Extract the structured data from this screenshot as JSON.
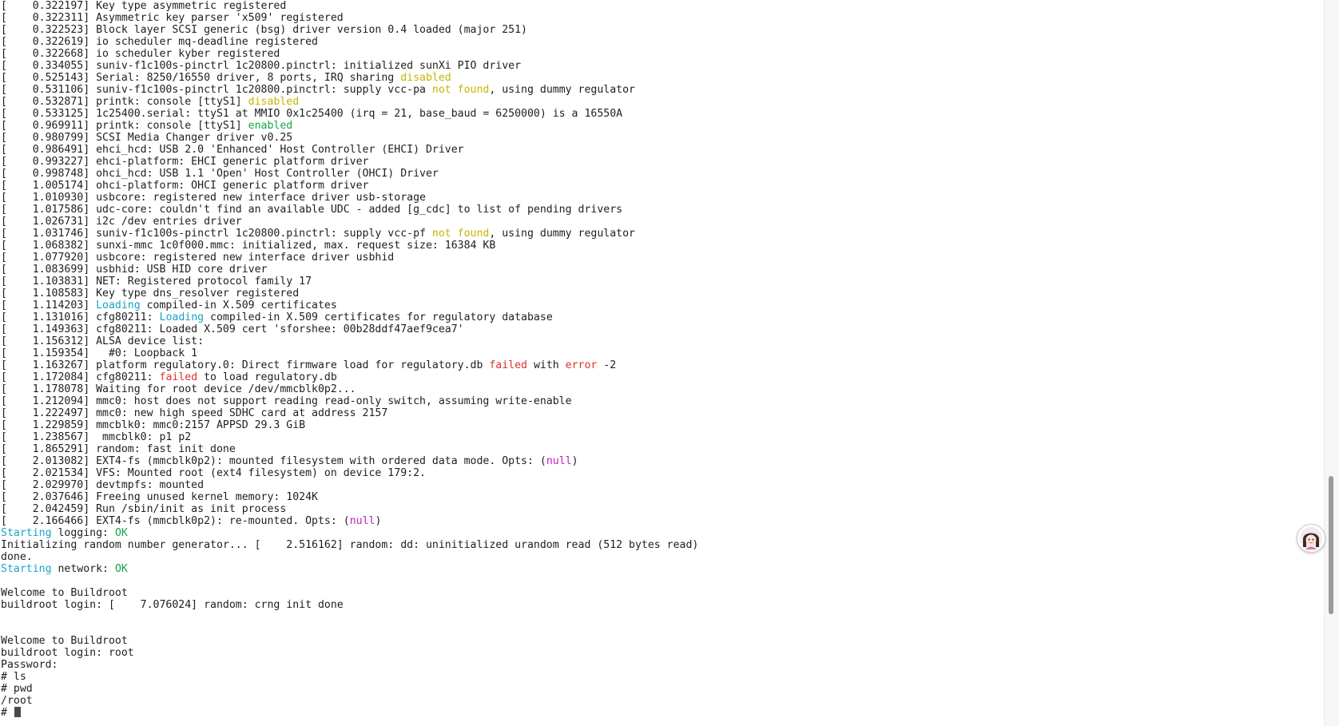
{
  "colors": {
    "plain": "#1e1e1e",
    "yellow": "#c8b400",
    "green": "#17a34a",
    "cyan": "#1aa3c2",
    "red": "#e0302b",
    "magenta": "#c020c0"
  },
  "scrollbar": {
    "position_fraction": 0.81,
    "visible_fraction": 0.19
  },
  "avatar": {
    "icon": "assistant-avatar-icon"
  },
  "terminal": {
    "lines": [
      [
        [
          "plain",
          "[    0.322197] Key type asymmetric registered"
        ]
      ],
      [
        [
          "plain",
          "[    0.322311] Asymmetric key parser 'x509' registered"
        ]
      ],
      [
        [
          "plain",
          "[    0.322523] Block layer SCSI generic (bsg) driver version 0.4 loaded (major 251)"
        ]
      ],
      [
        [
          "plain",
          "[    0.322619] io scheduler mq-deadline registered"
        ]
      ],
      [
        [
          "plain",
          "[    0.322668] io scheduler kyber registered"
        ]
      ],
      [
        [
          "plain",
          "[    0.334055] suniv-f1c100s-pinctrl 1c20800.pinctrl: initialized sunXi PIO driver"
        ]
      ],
      [
        [
          "plain",
          "[    0.525143] Serial: 8250/16550 driver, 8 ports, IRQ sharing "
        ],
        [
          "yellow",
          "disabled"
        ]
      ],
      [
        [
          "plain",
          "[    0.531106] suniv-f1c100s-pinctrl 1c20800.pinctrl: supply vcc-pa "
        ],
        [
          "yellow",
          "not found"
        ],
        [
          "plain",
          ", using dummy regulator"
        ]
      ],
      [
        [
          "plain",
          "[    0.532871] printk: console [ttyS1] "
        ],
        [
          "yellow",
          "disabled"
        ]
      ],
      [
        [
          "plain",
          "[    0.533125] 1c25400.serial: ttyS1 at MMIO 0x1c25400 (irq = 21, base_baud = 6250000) is a 16550A"
        ]
      ],
      [
        [
          "plain",
          "[    0.969911] printk: console [ttyS1] "
        ],
        [
          "green",
          "enabled"
        ]
      ],
      [
        [
          "plain",
          "[    0.980799] SCSI Media Changer driver v0.25"
        ]
      ],
      [
        [
          "plain",
          "[    0.986491] ehci_hcd: USB 2.0 'Enhanced' Host Controller (EHCI) Driver"
        ]
      ],
      [
        [
          "plain",
          "[    0.993227] ehci-platform: EHCI generic platform driver"
        ]
      ],
      [
        [
          "plain",
          "[    0.998748] ohci_hcd: USB 1.1 'Open' Host Controller (OHCI) Driver"
        ]
      ],
      [
        [
          "plain",
          "[    1.005174] ohci-platform: OHCI generic platform driver"
        ]
      ],
      [
        [
          "plain",
          "[    1.010930] usbcore: registered new interface driver usb-storage"
        ]
      ],
      [
        [
          "plain",
          "[    1.017586] udc-core: couldn't find an available UDC - added [g_cdc] to list of pending drivers"
        ]
      ],
      [
        [
          "plain",
          "[    1.026731] i2c /dev entries driver"
        ]
      ],
      [
        [
          "plain",
          "[    1.031746] suniv-f1c100s-pinctrl 1c20800.pinctrl: supply vcc-pf "
        ],
        [
          "yellow",
          "not found"
        ],
        [
          "plain",
          ", using dummy regulator"
        ]
      ],
      [
        [
          "plain",
          "[    1.068382] sunxi-mmc 1c0f000.mmc: initialized, max. request size: 16384 KB"
        ]
      ],
      [
        [
          "plain",
          "[    1.077920] usbcore: registered new interface driver usbhid"
        ]
      ],
      [
        [
          "plain",
          "[    1.083699] usbhid: USB HID core driver"
        ]
      ],
      [
        [
          "plain",
          "[    1.103831] NET: Registered protocol family 17"
        ]
      ],
      [
        [
          "plain",
          "[    1.108583] Key type dns_resolver registered"
        ]
      ],
      [
        [
          "plain",
          "[    1.114203] "
        ],
        [
          "cyan",
          "Loading"
        ],
        [
          "plain",
          " compiled-in X.509 certificates"
        ]
      ],
      [
        [
          "plain",
          "[    1.131016] cfg80211: "
        ],
        [
          "cyan",
          "Loading"
        ],
        [
          "plain",
          " compiled-in X.509 certificates for regulatory database"
        ]
      ],
      [
        [
          "plain",
          "[    1.149363] cfg80211: Loaded X.509 cert 'sforshee: 00b28ddf47aef9cea7'"
        ]
      ],
      [
        [
          "plain",
          "[    1.156312] ALSA device list:"
        ]
      ],
      [
        [
          "plain",
          "[    1.159354]   #0: Loopback 1"
        ]
      ],
      [
        [
          "plain",
          "[    1.163267] platform regulatory.0: Direct firmware load for regulatory.db "
        ],
        [
          "red",
          "failed"
        ],
        [
          "plain",
          " with "
        ],
        [
          "red",
          "error"
        ],
        [
          "plain",
          " -2"
        ]
      ],
      [
        [
          "plain",
          "[    1.172084] cfg80211: "
        ],
        [
          "red",
          "failed"
        ],
        [
          "plain",
          " to load regulatory.db"
        ]
      ],
      [
        [
          "plain",
          "[    1.178078] Waiting for root device /dev/mmcblk0p2..."
        ]
      ],
      [
        [
          "plain",
          "[    1.212094] mmc0: host does not support reading read-only switch, assuming write-enable"
        ]
      ],
      [
        [
          "plain",
          "[    1.222497] mmc0: new high speed SDHC card at address 2157"
        ]
      ],
      [
        [
          "plain",
          "[    1.229859] mmcblk0: mmc0:2157 APPSD 29.3 GiB"
        ]
      ],
      [
        [
          "plain",
          "[    1.238567]  mmcblk0: p1 p2"
        ]
      ],
      [
        [
          "plain",
          "[    1.865291] random: fast init done"
        ]
      ],
      [
        [
          "plain",
          "[    2.013082] EXT4-fs (mmcblk0p2): mounted filesystem with ordered data mode. Opts: ("
        ],
        [
          "magenta",
          "null"
        ],
        [
          "plain",
          ")"
        ]
      ],
      [
        [
          "plain",
          "[    2.021534] VFS: Mounted root (ext4 filesystem) on device 179:2."
        ]
      ],
      [
        [
          "plain",
          "[    2.029970] devtmpfs: mounted"
        ]
      ],
      [
        [
          "plain",
          "[    2.037646] Freeing unused kernel memory: 1024K"
        ]
      ],
      [
        [
          "plain",
          "[    2.042459] Run /sbin/init as init process"
        ]
      ],
      [
        [
          "plain",
          "[    2.166466] EXT4-fs (mmcblk0p2): re-mounted. Opts: ("
        ],
        [
          "magenta",
          "null"
        ],
        [
          "plain",
          ")"
        ]
      ],
      [
        [
          "cyan",
          "Starting"
        ],
        [
          "plain",
          " logging: "
        ],
        [
          "green",
          "OK"
        ]
      ],
      [
        [
          "plain",
          "Initializing random number generator... [    2.516162] random: dd: uninitialized urandom read (512 bytes read)"
        ]
      ],
      [
        [
          "plain",
          "done."
        ]
      ],
      [
        [
          "cyan",
          "Starting"
        ],
        [
          "plain",
          " network: "
        ],
        [
          "green",
          "OK"
        ]
      ],
      [
        [
          "plain",
          ""
        ]
      ],
      [
        [
          "plain",
          "Welcome to Buildroot"
        ]
      ],
      [
        [
          "plain",
          "buildroot login: [    7.076024] random: crng init done"
        ]
      ],
      [
        [
          "plain",
          ""
        ]
      ],
      [
        [
          "plain",
          ""
        ]
      ],
      [
        [
          "plain",
          "Welcome to Buildroot"
        ]
      ],
      [
        [
          "plain",
          "buildroot login: root"
        ]
      ],
      [
        [
          "plain",
          "Password:"
        ]
      ],
      [
        [
          "plain",
          "# ls"
        ]
      ],
      [
        [
          "plain",
          "# pwd"
        ]
      ],
      [
        [
          "plain",
          "/root"
        ]
      ],
      [
        [
          "plain",
          "# "
        ]
      ]
    ]
  }
}
